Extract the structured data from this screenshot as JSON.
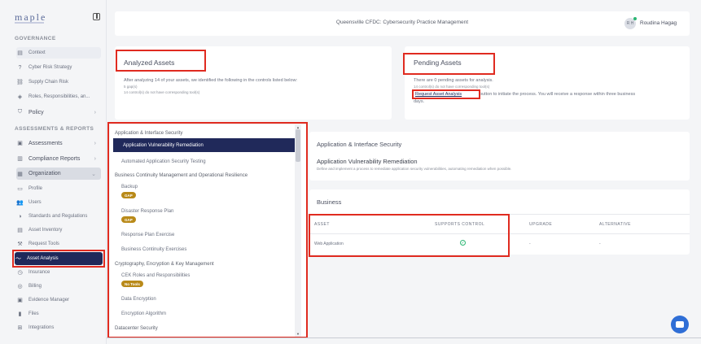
{
  "sidebar": {
    "logo": "maple",
    "governance_title": "GOVERNANCE",
    "governance_items": [
      "Context",
      "Cyber Risk Strategy",
      "Supply Chain Risk",
      "Roles, Responsibilities, an...",
      "Policy"
    ],
    "assessments_title": "ASSESSMENTS & REPORTS",
    "assessments_items": [
      "Assessments",
      "Compliance Reports",
      "Organization"
    ],
    "org_items": [
      "Profile",
      "Users",
      "Standards and Regulations",
      "Asset Inventory",
      "Request Tools",
      "Asset Analysis",
      "Insurance",
      "Billing",
      "Evidence Manager",
      "Files",
      "Integrations"
    ]
  },
  "header": {
    "title": "Queensville CFDC: Cybersecurity Practice Management",
    "avatar_initials": "R H",
    "username": "Roudina Hagag"
  },
  "analyzed": {
    "title": "Analyzed Assets",
    "line1": "After analyzing 14 of your assets, we identified the following in the controls listed below:",
    "line2": "5 gap(s)",
    "line3": "14 control(s) do not have corresponding tool(s)"
  },
  "pending": {
    "title": "Pending Assets",
    "line1": "There are 0 pending assets for analysis.",
    "line2": "14 control(s) do not have corresponding tool(s)",
    "button": "Request Asset Analysis",
    "line3": "button to initiate the process. You will receive a response within three business",
    "line4": "days."
  },
  "controls": {
    "items": [
      {
        "type": "cat",
        "label": "Application & Interface Security"
      },
      {
        "type": "selected",
        "label": "Application Vulnerability Remediation"
      },
      {
        "type": "sub",
        "label": "Automated Application Security Testing"
      },
      {
        "type": "cat",
        "label": "Business Continuity Management and Operational Resilience"
      },
      {
        "type": "sub",
        "label": "Backup",
        "badge": "GAP"
      },
      {
        "type": "sub",
        "label": "Disaster Response Plan",
        "badge": "GAP"
      },
      {
        "type": "sub",
        "label": "Response Plan Exercise"
      },
      {
        "type": "sub",
        "label": "Business Continuity Exercises"
      },
      {
        "type": "cat",
        "label": "Cryptography, Encryption & Key Management"
      },
      {
        "type": "sub",
        "label": "CEK Roles and Responsibilities",
        "badge": "No Tools"
      },
      {
        "type": "sub",
        "label": "Data Encryption"
      },
      {
        "type": "sub",
        "label": "Encryption Algorithm"
      },
      {
        "type": "cat",
        "label": "Datacenter Security"
      }
    ]
  },
  "detail": {
    "category": "Application & Interface Security",
    "control_title": "Application Vulnerability Remediation",
    "control_desc": "Define and implement a process to remediate application security vulnerabilities, automating remediation when possible."
  },
  "business": {
    "title": "Business",
    "columns": [
      "ASSET",
      "SUPPORTS CONTROL",
      "UPGRADE",
      "ALTERNATIVE"
    ],
    "rows": [
      {
        "asset": "Web Application",
        "supports": "✓",
        "upgrade": "-",
        "alternative": "-"
      }
    ]
  },
  "colors": {
    "navy": "#20295a",
    "gap": "#b98a19",
    "accent_red": "#e02b20",
    "check": "#2bb673"
  }
}
